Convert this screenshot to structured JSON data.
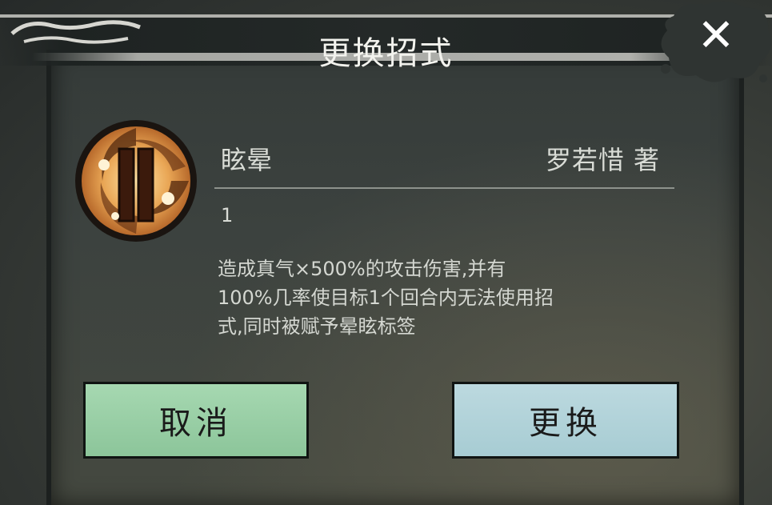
{
  "dialog": {
    "title": "更换招式"
  },
  "skill": {
    "name": "眩晕",
    "author": "罗若惜 著",
    "level": "1",
    "description_lines": [
      "造成真气×500%的攻击伤害,并有",
      "100%几率使目标1个回合内无法使用招",
      "式,同时被赋予晕眩标签"
    ],
    "icon": "stun-skill-icon"
  },
  "buttons": {
    "cancel_label": "取消",
    "swap_label": "更换",
    "close_icon": "close-icon"
  },
  "colors": {
    "cancel_button": "#98cea5",
    "swap_button": "#b2d3d9",
    "text": "#d9dcd6"
  }
}
